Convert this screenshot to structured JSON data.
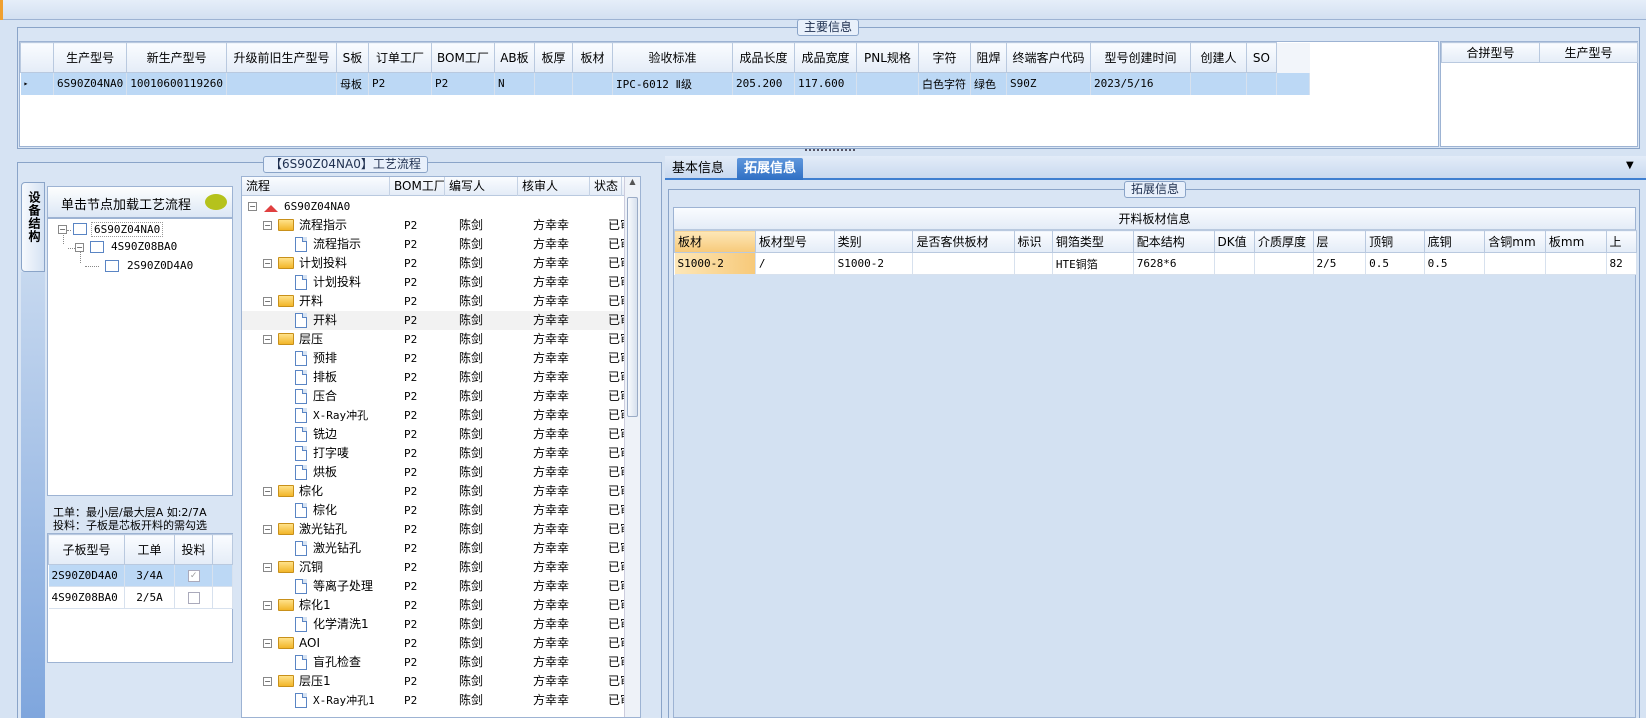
{
  "main_info": {
    "legend": "主要信息",
    "columns": [
      "生产型号",
      "新生产型号",
      "升级前旧生产型号",
      "S板",
      "订单工厂",
      "BOM工厂",
      "AB板",
      "板厚",
      "板材",
      "验收标准",
      "成品长度",
      "成品宽度",
      "PNL规格",
      "字符",
      "阻焊",
      "终端客户代码",
      "型号创建时间",
      "创建人",
      "SO"
    ],
    "row": [
      "6S90Z04NA0",
      "10010600119260",
      "",
      "母板",
      "P2",
      "P2",
      "N",
      "",
      "",
      "IPC-6012 Ⅱ级",
      "205.200",
      "117.600",
      "",
      "白色字符",
      "绿色",
      "S90Z",
      "2023/5/16",
      "",
      ""
    ],
    "right_columns": [
      "合拼型号",
      "生产型号"
    ]
  },
  "process": {
    "legend": "【6S90Z04NA0】工艺流程",
    "side_tab": "设备结构",
    "tree_header": "单击节点加载工艺流程",
    "tree": [
      {
        "label": "6S90Z04NA0",
        "level": 0
      },
      {
        "label": "4S90Z08BA0",
        "level": 1
      },
      {
        "label": "2S90Z0D4A0",
        "level": 2
      }
    ],
    "note_line1": "工单：最小层/最大层A 如:2/7A",
    "note_line2": "投料：子板是芯板开料的需勾选",
    "sub_columns": [
      "子板型号",
      "工单",
      "投料"
    ],
    "sub_rows": [
      {
        "model": "2S90Z0D4A0",
        "order": "3/4A",
        "checked": true
      },
      {
        "model": "4S90Z08BA0",
        "order": "2/5A",
        "checked": false
      }
    ],
    "flow_columns": [
      "流程",
      "BOM工厂",
      "编写人",
      "核审人",
      "状态"
    ],
    "flow_root": "6S90Z04NA0",
    "flow_rows": [
      {
        "name": "流程指示",
        "type": "folder",
        "bom": "P2",
        "writer": "陈剑",
        "reviewer": "方幸幸",
        "status": "已审核"
      },
      {
        "name": "流程指示",
        "type": "doc",
        "bom": "P2",
        "writer": "陈剑",
        "reviewer": "方幸幸",
        "status": "已审核"
      },
      {
        "name": "计划投料",
        "type": "folder",
        "bom": "P2",
        "writer": "陈剑",
        "reviewer": "方幸幸",
        "status": "已审核"
      },
      {
        "name": "计划投料",
        "type": "doc",
        "bom": "P2",
        "writer": "陈剑",
        "reviewer": "方幸幸",
        "status": "已审核"
      },
      {
        "name": "开料",
        "type": "folder",
        "bom": "P2",
        "writer": "陈剑",
        "reviewer": "方幸幸",
        "status": "已审核"
      },
      {
        "name": "开料",
        "type": "doc",
        "bom": "P2",
        "writer": "陈剑",
        "reviewer": "方幸幸",
        "status": "已审核"
      },
      {
        "name": "层压",
        "type": "folder",
        "bom": "P2",
        "writer": "陈剑",
        "reviewer": "方幸幸",
        "status": "已审核"
      },
      {
        "name": "预排",
        "type": "doc",
        "bom": "P2",
        "writer": "陈剑",
        "reviewer": "方幸幸",
        "status": "已审核"
      },
      {
        "name": "排板",
        "type": "doc",
        "bom": "P2",
        "writer": "陈剑",
        "reviewer": "方幸幸",
        "status": "已审核"
      },
      {
        "name": "压合",
        "type": "doc",
        "bom": "P2",
        "writer": "陈剑",
        "reviewer": "方幸幸",
        "status": "已审核"
      },
      {
        "name": "X-Ray冲孔",
        "type": "doc",
        "bom": "P2",
        "writer": "陈剑",
        "reviewer": "方幸幸",
        "status": "已审核"
      },
      {
        "name": "铣边",
        "type": "doc",
        "bom": "P2",
        "writer": "陈剑",
        "reviewer": "方幸幸",
        "status": "已审核"
      },
      {
        "name": "打字唛",
        "type": "doc",
        "bom": "P2",
        "writer": "陈剑",
        "reviewer": "方幸幸",
        "status": "已审核"
      },
      {
        "name": "烘板",
        "type": "doc",
        "bom": "P2",
        "writer": "陈剑",
        "reviewer": "方幸幸",
        "status": "已审核"
      },
      {
        "name": "棕化",
        "type": "folder",
        "bom": "P2",
        "writer": "陈剑",
        "reviewer": "方幸幸",
        "status": "已审核"
      },
      {
        "name": "棕化",
        "type": "doc",
        "bom": "P2",
        "writer": "陈剑",
        "reviewer": "方幸幸",
        "status": "已审核"
      },
      {
        "name": "激光钻孔",
        "type": "folder",
        "bom": "P2",
        "writer": "陈剑",
        "reviewer": "方幸幸",
        "status": "已审核"
      },
      {
        "name": "激光钻孔",
        "type": "doc",
        "bom": "P2",
        "writer": "陈剑",
        "reviewer": "方幸幸",
        "status": "已审核"
      },
      {
        "name": "沉铜",
        "type": "folder",
        "bom": "P2",
        "writer": "陈剑",
        "reviewer": "方幸幸",
        "status": "已审核"
      },
      {
        "name": "等离子处理",
        "type": "doc",
        "bom": "P2",
        "writer": "陈剑",
        "reviewer": "方幸幸",
        "status": "已审核"
      },
      {
        "name": "棕化1",
        "type": "folder",
        "bom": "P2",
        "writer": "陈剑",
        "reviewer": "方幸幸",
        "status": "已审核"
      },
      {
        "name": "化学清洗1",
        "type": "doc",
        "bom": "P2",
        "writer": "陈剑",
        "reviewer": "方幸幸",
        "status": "已审核"
      },
      {
        "name": "AOI",
        "type": "folder",
        "bom": "P2",
        "writer": "陈剑",
        "reviewer": "方幸幸",
        "status": "已审核"
      },
      {
        "name": "盲孔检查",
        "type": "doc",
        "bom": "P2",
        "writer": "陈剑",
        "reviewer": "方幸幸",
        "status": "已审核"
      },
      {
        "name": "层压1",
        "type": "folder",
        "bom": "P2",
        "writer": "陈剑",
        "reviewer": "方幸幸",
        "status": "已审核"
      },
      {
        "name": "X-Ray冲孔1",
        "type": "doc",
        "bom": "P2",
        "writer": "陈剑",
        "reviewer": "方幸幸",
        "status": "已审核"
      }
    ]
  },
  "tabs": [
    "基本信息",
    "拓展信息"
  ],
  "extended": {
    "legend": "拓展信息",
    "table_title": "开料板材信息",
    "columns": [
      "板材",
      "板材型号",
      "类别",
      "是否客供板材",
      "标识",
      "铜箔类型",
      "配本结构",
      "DK值",
      "介质厚度",
      "层",
      "顶铜",
      "底铜",
      "含铜mm",
      "板mm",
      "上"
    ],
    "row": [
      "S1000-2",
      "/",
      "S1000-2",
      "",
      "",
      "HTE铜箔",
      "7628*6",
      "",
      "",
      "2/5",
      "0.5",
      "0.5",
      "",
      "",
      "82"
    ]
  }
}
